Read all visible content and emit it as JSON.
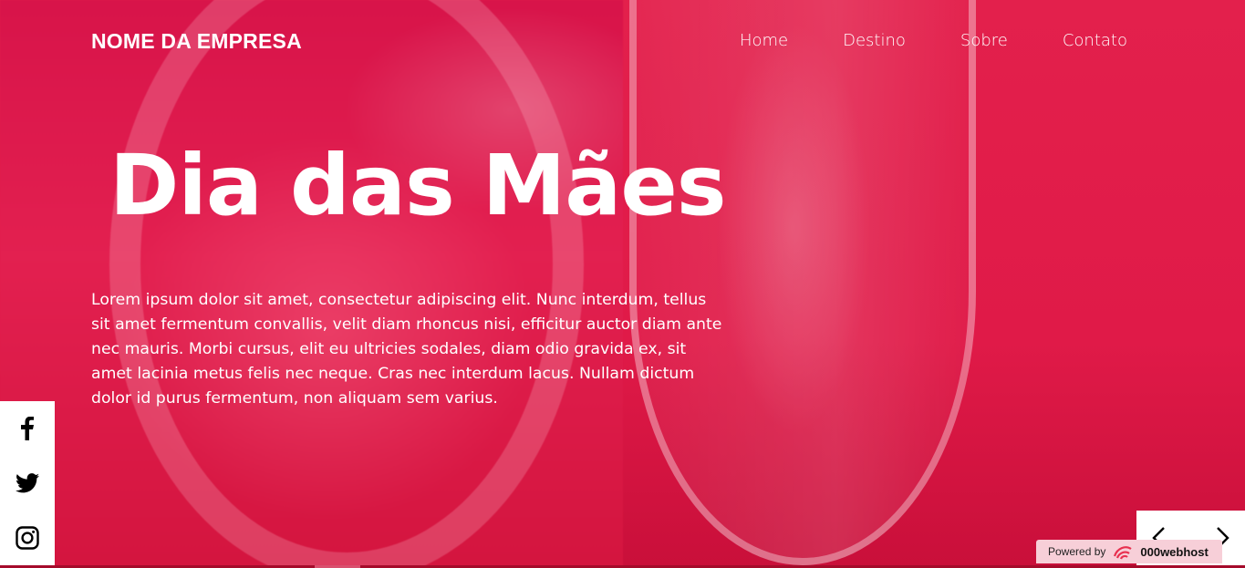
{
  "header": {
    "brand": "NOME DA EMPRESA",
    "nav": [
      {
        "label": "Home"
      },
      {
        "label": "Destino"
      },
      {
        "label": "Sobre"
      },
      {
        "label": "Contato"
      }
    ]
  },
  "hero": {
    "title": "Dia das Mães",
    "text": "Lorem ipsum dolor sit amet, consectetur adipiscing elit. Nunc interdum, tellus sit amet fermentum convallis, velit diam rhoncus nisi, efficitur auctor diam ante nec mauris. Morbi cursus, elit eu ultricies sodales, diam odio gravida ex, sit amet lacinia metus felis nec neque. Cras nec interdum lacus. Nullam dictum dolor id purus fermentum, non aliquam sem varius."
  },
  "social": {
    "icons": [
      "facebook-icon",
      "twitter-icon",
      "instagram-icon"
    ]
  },
  "slider": {
    "prev_icon": "chevron-left-icon",
    "next_icon": "chevron-right-icon"
  },
  "badge": {
    "powered_label": "Powered by",
    "host_label": "000webhost"
  },
  "colors": {
    "background": "#e01a48",
    "text": "#ffffff",
    "panel": "#ffffff"
  }
}
